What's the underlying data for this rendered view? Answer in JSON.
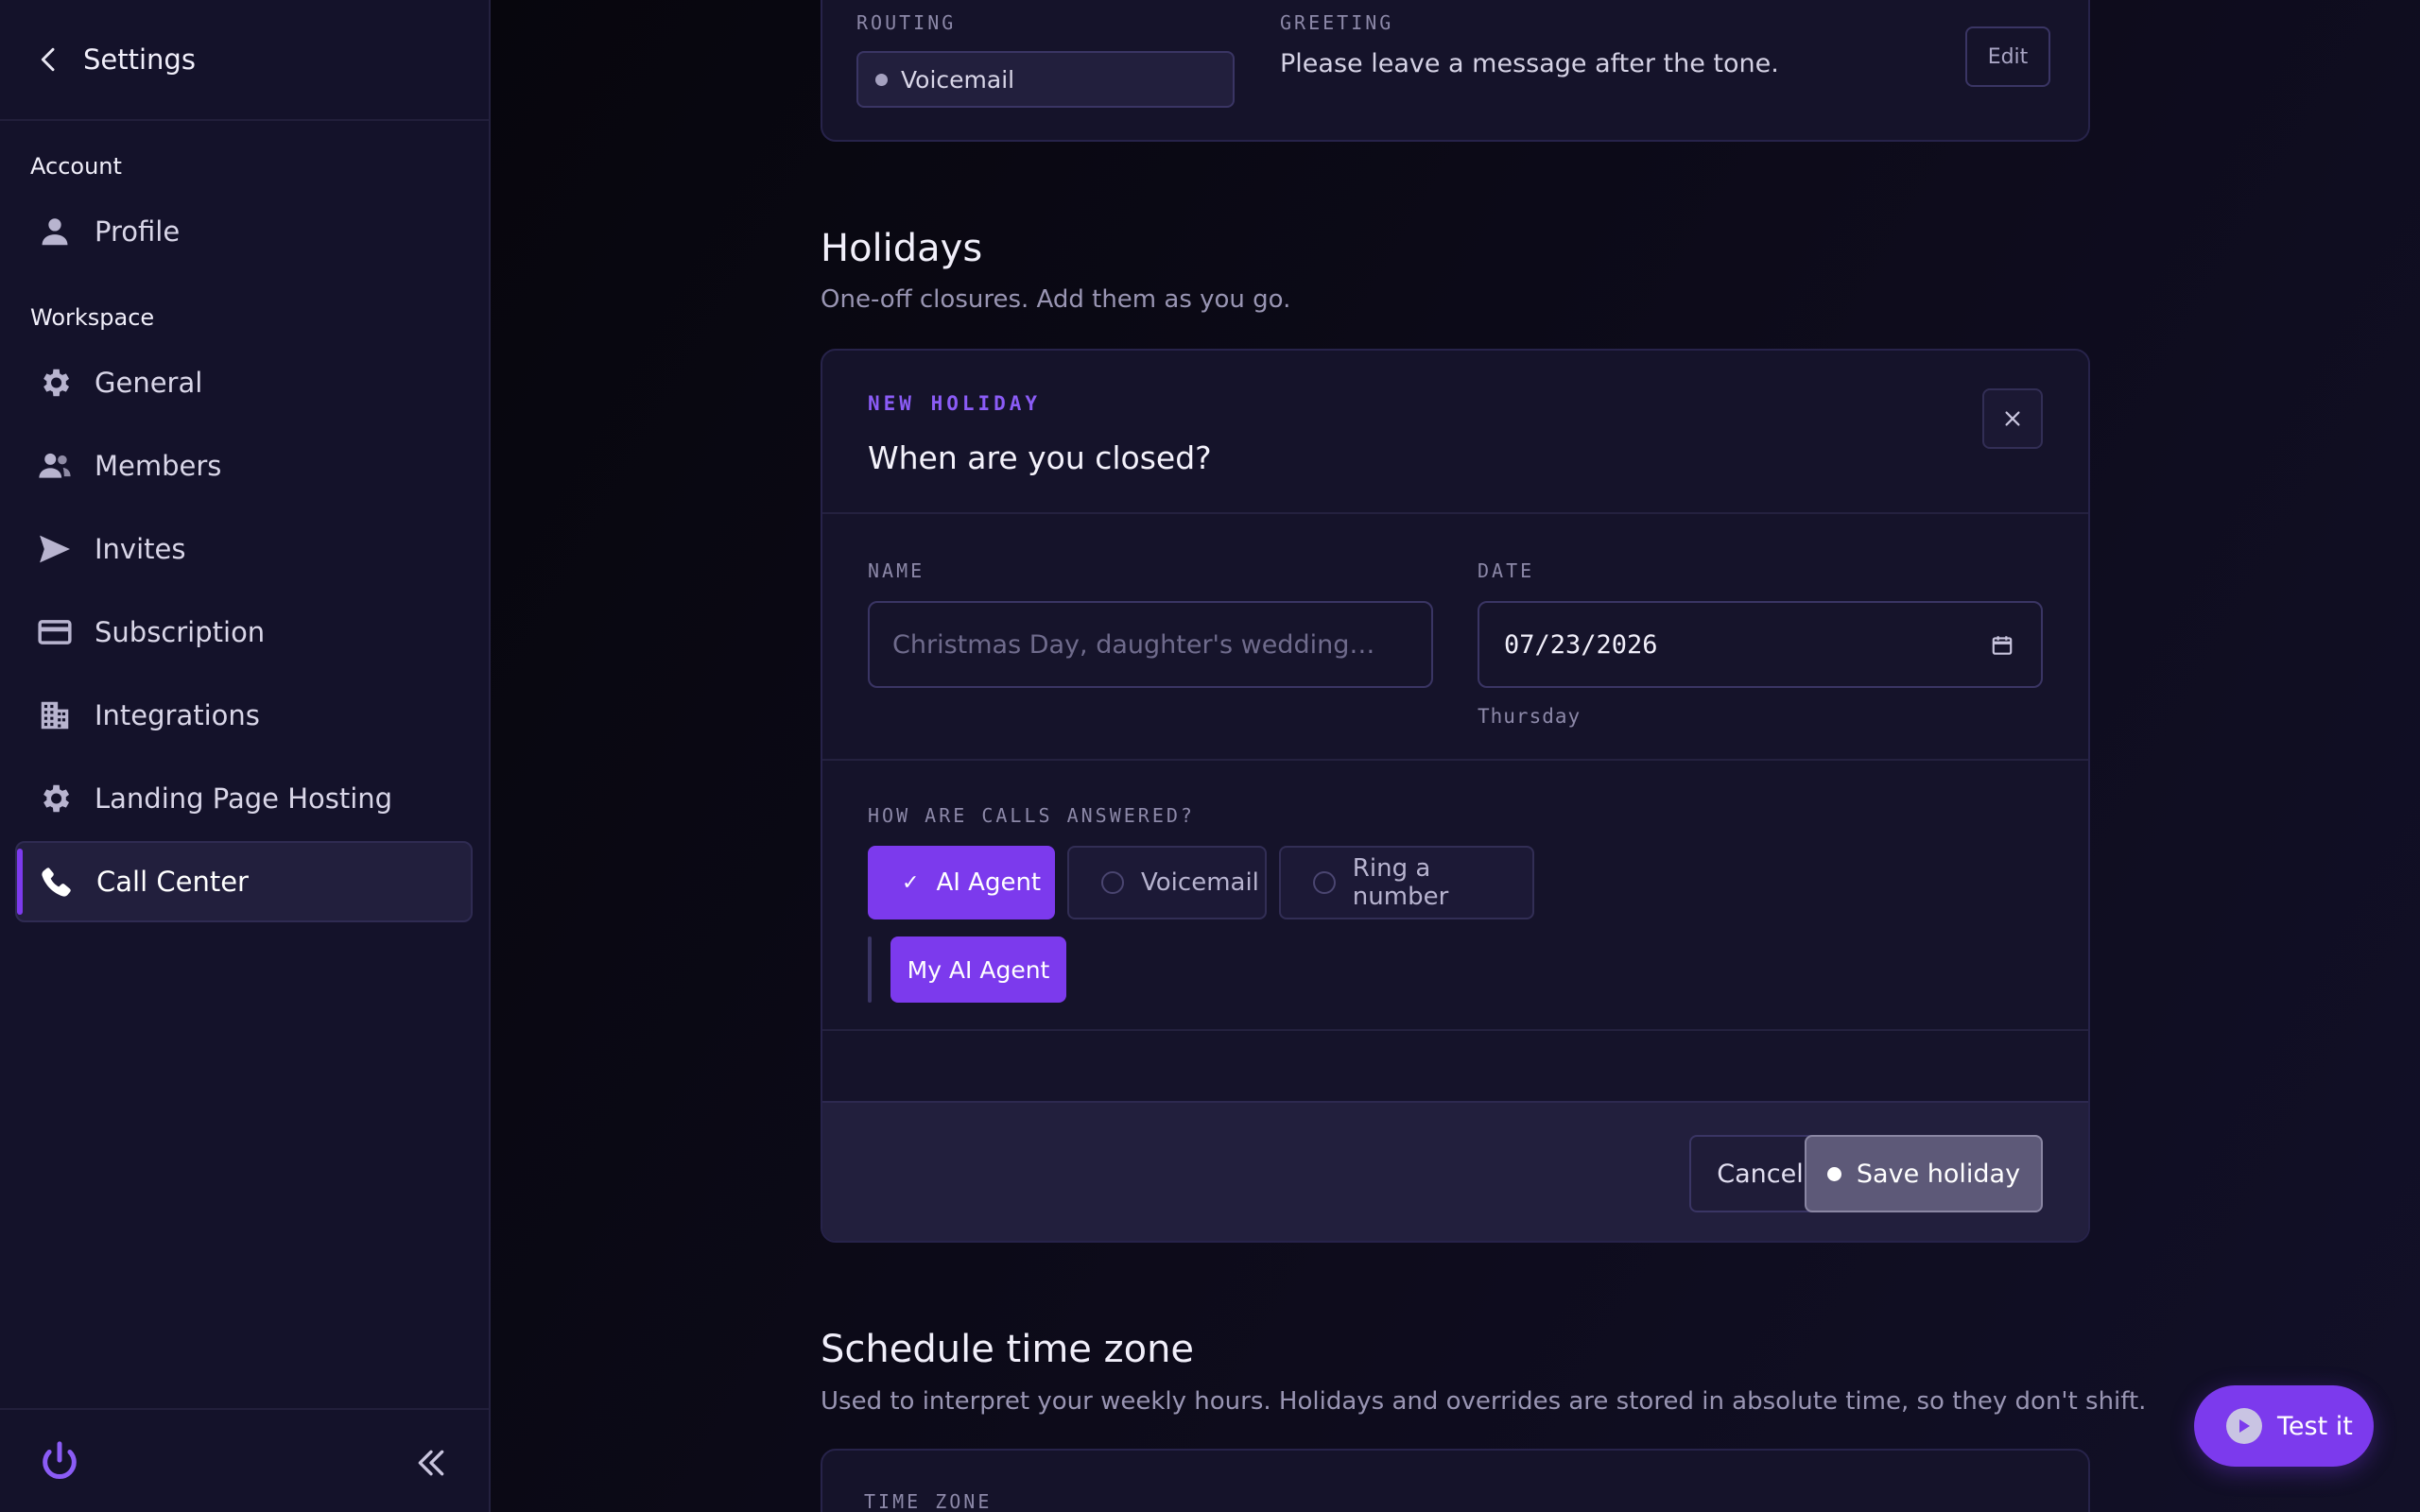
{
  "sidebar": {
    "title": "Settings",
    "sections": {
      "account": "Account",
      "workspace": "Workspace"
    },
    "items": [
      {
        "label": "Profile",
        "icon": "person-icon"
      },
      {
        "label": "General",
        "icon": "gear-icon"
      },
      {
        "label": "Members",
        "icon": "users-icon"
      },
      {
        "label": "Invites",
        "icon": "send-icon"
      },
      {
        "label": "Subscription",
        "icon": "credit-card-icon"
      },
      {
        "label": "Integrations",
        "icon": "building-icon"
      },
      {
        "label": "Landing Page Hosting",
        "icon": "gear-icon"
      },
      {
        "label": "Call Center",
        "icon": "phone-icon",
        "active": true
      }
    ]
  },
  "routing_card": {
    "routing_label": "ROUTING",
    "routing_value": "Voicemail",
    "greeting_label": "GREETING",
    "greeting_text": "Please leave a message after the tone.",
    "edit_label": "Edit"
  },
  "holidays": {
    "title": "Holidays",
    "subtitle": "One-off closures. Add them as you go.",
    "form": {
      "eyebrow": "NEW HOLIDAY",
      "question": "When are you closed?",
      "name_label": "NAME",
      "name_placeholder": "Christmas Day, daughter's wedding…",
      "name_value": "",
      "date_label": "DATE",
      "date_value": "07/23/2026",
      "weekday": "Thursday",
      "calls_label": "HOW ARE CALLS ANSWERED?",
      "options": [
        {
          "label": "AI Agent",
          "selected": true
        },
        {
          "label": "Voicemail",
          "selected": false
        },
        {
          "label": "Ring a number",
          "selected": false
        }
      ],
      "agent_label": "My AI Agent",
      "cancel_label": "Cancel",
      "save_label": "Save holiday"
    }
  },
  "timezone": {
    "title": "Schedule time zone",
    "subtitle": "Used to interpret your weekly hours. Holidays and overrides are stored in absolute time, so they don't shift.",
    "field_label": "TIME ZONE"
  },
  "test_button": {
    "label": "Test it"
  },
  "colors": {
    "accent": "#7c3aed",
    "sidebar_bg": "#14122a",
    "card_bg": "#15132a"
  }
}
